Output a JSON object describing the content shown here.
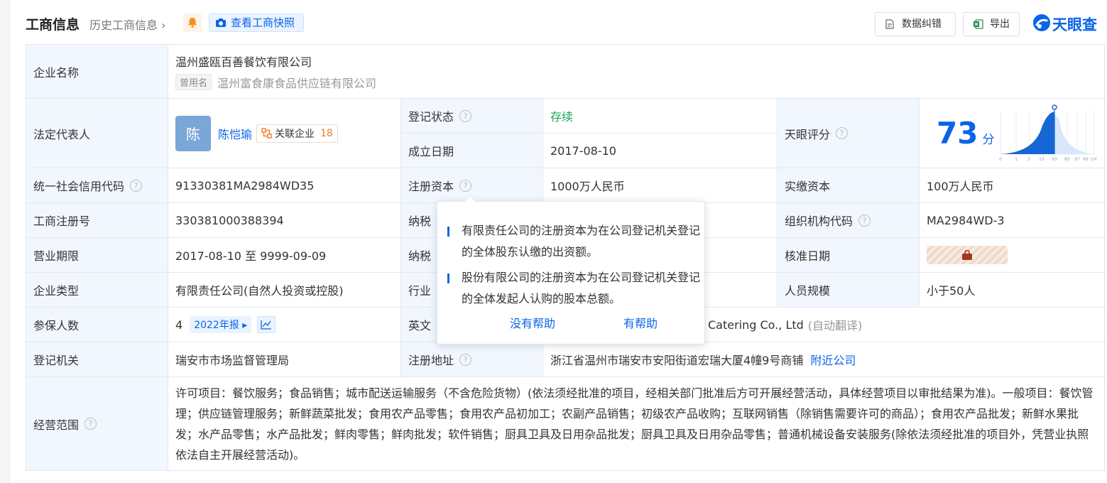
{
  "header": {
    "title": "工商信息",
    "history_link": "历史工商信息 ›",
    "snapshot_button": "查看工商快照",
    "correction_button": "数据纠错",
    "export_button": "导出",
    "brand": "天眼查"
  },
  "rows": {
    "company_name": {
      "label": "企业名称",
      "value": "温州盛瓯百善餐饮有限公司",
      "former_tag": "曾用名",
      "former_name": "温州富食康食品供应链有限公司"
    },
    "legal_rep": {
      "label": "法定代表人",
      "avatar_char": "陈",
      "name": "陈恺瑜",
      "related_label": "关联企业",
      "related_count": "18"
    },
    "reg_status": {
      "label": "登记状态",
      "value": "存续"
    },
    "founded": {
      "label": "成立日期",
      "value": "2017-08-10"
    },
    "tianyan_score": {
      "label": "天眼评分",
      "value": "73",
      "unit": "分",
      "chart_ticks": [
        "0",
        "1",
        "3",
        "15",
        "50",
        "85",
        "97",
        "99",
        "100"
      ]
    },
    "credit_code": {
      "label": "统一社会信用代码",
      "value": "91330381MA2984WD35"
    },
    "reg_capital": {
      "label": "注册资本",
      "value": "1000万人民币"
    },
    "paid_capital": {
      "label": "实缴资本",
      "value": "100万人民币"
    },
    "reg_number": {
      "label": "工商注册号",
      "value": "330381000388394"
    },
    "taxpayer_a": {
      "label_partial": "纳税"
    },
    "org_code": {
      "label": "组织机构代码",
      "value": "MA2984WD-3"
    },
    "term": {
      "label": "营业期限",
      "value": "2017-08-10 至 9999-09-09"
    },
    "taxpayer_b": {
      "label_partial": "纳税"
    },
    "approval_date": {
      "label": "核准日期"
    },
    "company_type": {
      "label": "企业类型",
      "value": "有限责任公司(自然人投资或控股)"
    },
    "industry": {
      "label_partial": "行业"
    },
    "staff_size": {
      "label": "人员规模",
      "value": "小于50人"
    },
    "insured": {
      "label": "参保人数",
      "value": "4",
      "report": "2022年报 ▸"
    },
    "english_name": {
      "label_partial": "英文",
      "value_partial": "Catering Co., Ltd",
      "auto_translate": "(自动翻译)"
    },
    "authority": {
      "label": "登记机关",
      "value": "瑞安市市场监督管理局"
    },
    "address": {
      "label": "注册地址",
      "value": "浙江省温州市瑞安市安阳街道宏瑞大厦4幢9号商铺",
      "nearby": "附近公司"
    },
    "scope": {
      "label": "经营范围",
      "value": "许可项目：餐饮服务；食品销售；城市配送运输服务（不含危险货物）(依法须经批准的项目，经相关部门批准后方可开展经营活动，具体经营项目以审批结果为准)。一般项目：餐饮管理；供应链管理服务；新鲜蔬菜批发；食用农产品零售；食用农产品初加工；农副产品销售；初级农产品收购；互联网销售（除销售需要许可的商品）；食用农产品批发；新鲜水果批发；水产品零售；水产品批发；鲜肉零售；鲜肉批发；软件销售；厨具卫具及日用杂品批发；厨具卫具及日用杂品零售；普通机械设备安装服务(除依法须经批准的项目外，凭营业执照依法自主开展经营活动)。"
    }
  },
  "tooltip": {
    "para1": "有限责任公司的注册资本为在公司登记机关登记的全体股东认缴的出资额。",
    "para2": "股份有限公司的注册资本为在公司登记机关登记的全体发起人认购的股本总额。",
    "not_helpful": "没有帮助",
    "helpful": "有帮助"
  },
  "colors": {
    "accent": "#0a64e8",
    "label_bg": "#f2f7ff",
    "status_green": "#17a55a",
    "related_orange": "#f07a2c"
  },
  "icons": [
    "bell-icon",
    "camera-icon",
    "document-icon",
    "excel-icon",
    "tianyancha-logo-icon",
    "help-icon",
    "related-company-icon",
    "trend-chart-icon",
    "lock-icon"
  ]
}
